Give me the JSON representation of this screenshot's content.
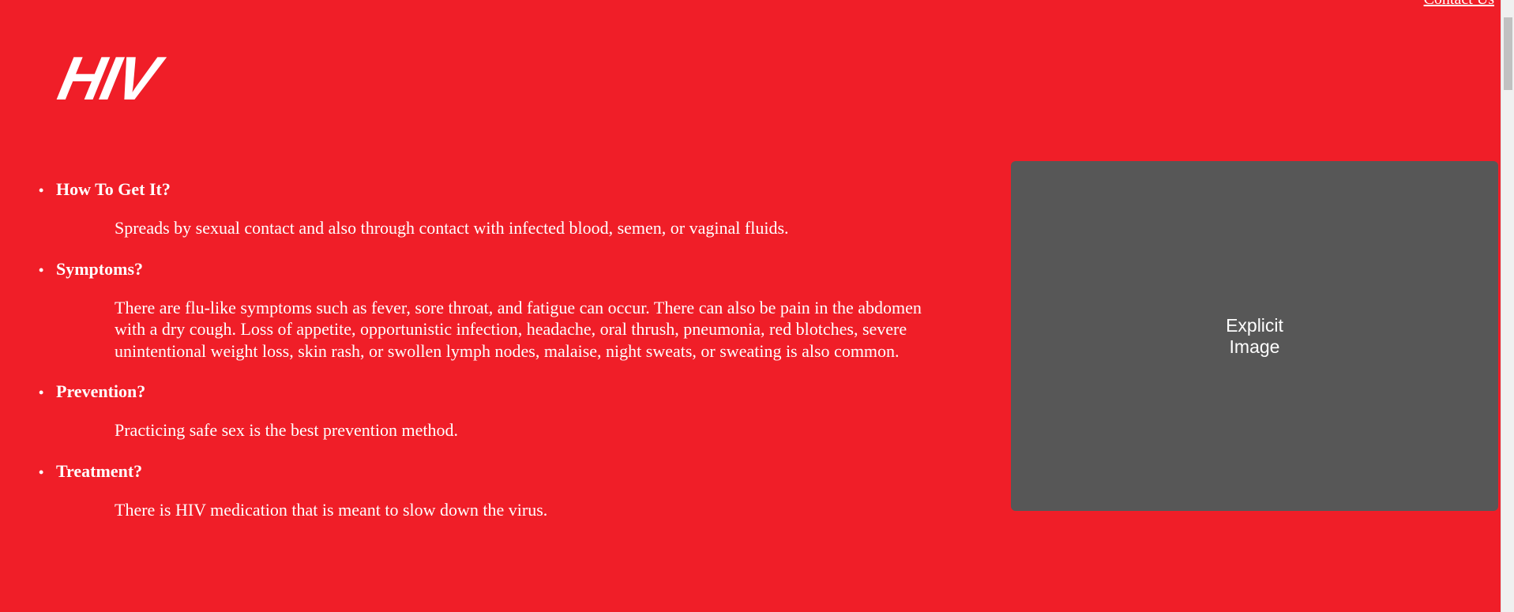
{
  "header": {
    "contact_link": "Contact Us",
    "logo_text": "HIV"
  },
  "topics": [
    {
      "heading": "How To Get It?",
      "text": "Spreads by sexual contact and also through contact with infected blood, semen, or vaginal fluids."
    },
    {
      "heading": "Symptoms?",
      "text": "There are flu-like symptoms such as fever, sore throat, and fatigue can occur. There can also be pain in the abdomen with a dry cough. Loss of appetite, opportunistic infection, headache, oral thrush, pneumonia, red blotches, severe unintentional weight loss, skin rash, or swollen lymph nodes, malaise, night sweats, or sweating is also common."
    },
    {
      "heading": "Prevention?",
      "text": "Practicing safe sex is the best prevention method."
    },
    {
      "heading": "Treatment?",
      "text": "There is HIV medication that is meant to slow down the virus."
    }
  ],
  "image": {
    "label": "Explicit Image"
  },
  "colors": {
    "background": "#F01E28",
    "placeholder": "#575757",
    "text": "#FFFFFF"
  }
}
